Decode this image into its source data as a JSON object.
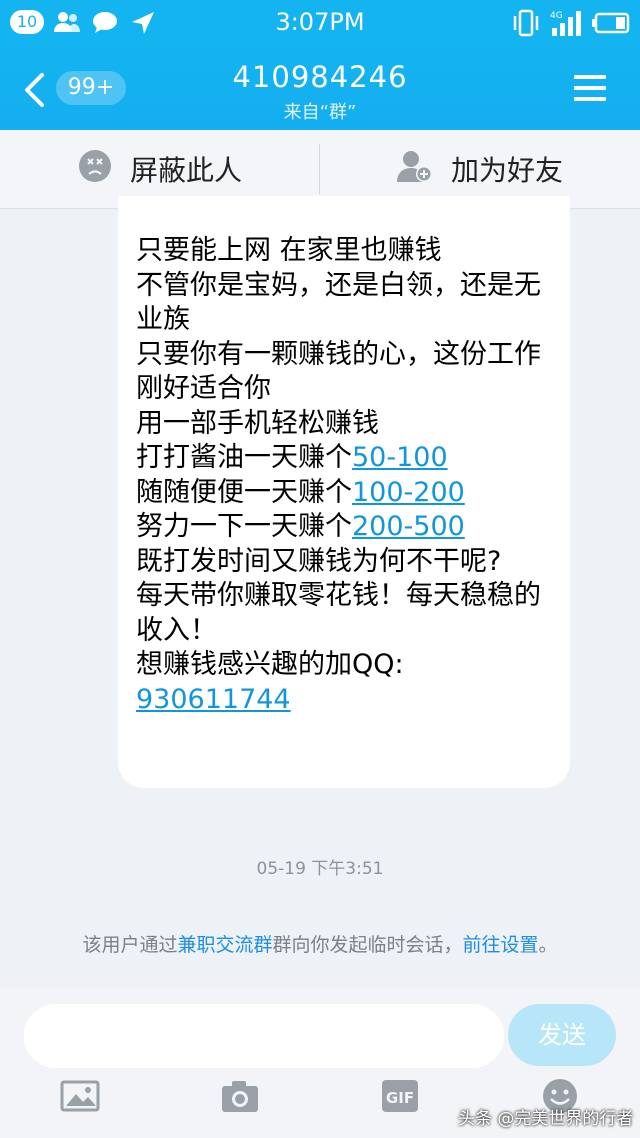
{
  "status_bar": {
    "notification_count": "10",
    "time": "3:07PM",
    "network": "4G"
  },
  "header": {
    "unread_badge": "99+",
    "title": "410984246",
    "subtitle": "来自“群”"
  },
  "actions": {
    "block": "屏蔽此人",
    "add_friend": "加为好友"
  },
  "message": {
    "line1": "只要能上网 在家里也赚钱",
    "line2": "不管你是宝妈，还是白领，还是无业族",
    "line3": "只要你有一颗赚钱的心，这份工作刚好适合你",
    "line4": "用一部手机轻松赚钱",
    "line5_prefix": "打打酱油一天赚个",
    "line5_link": "50-100",
    "line6_prefix": "随随便便一天赚个",
    "line6_link": "100-200",
    "line7_prefix": "努力一下一天赚个",
    "line7_link": "200-500",
    "line8": "既打发时间又赚钱为何不干呢?",
    "line9": "每天带你赚取零花钱！每天稳稳的收入！",
    "line10": "想赚钱感兴趣的加QQ:",
    "qq_link": "930611744"
  },
  "timestamp": "05-19 下午3:51",
  "notice": {
    "prefix": "该用户通过",
    "group_link": "兼职交流群",
    "middle": "群向你发起临时会话，",
    "settings_link": "前往设置",
    "suffix": "。"
  },
  "composer": {
    "input_value": "",
    "send_label": "发送",
    "gif_label": "GIF"
  },
  "watermark": "头条 @完美世界的行者",
  "colors": {
    "header_blue": "#14b4f0",
    "link_blue": "#1296db",
    "send_disabled": "#b8e6f9"
  }
}
